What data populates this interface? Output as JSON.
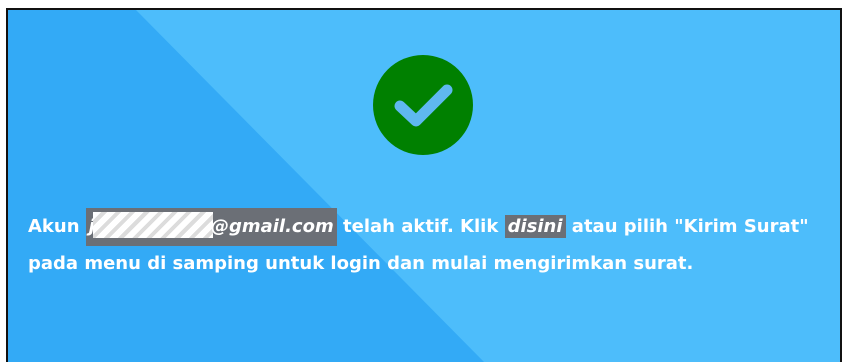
{
  "colors": {
    "background_light": "#4dbdfb",
    "background_dark": "#2fa9f5",
    "check_circle": "#008000",
    "highlight": "#6b6f76",
    "text": "#ffffff"
  },
  "icon": {
    "name": "check-circle-icon"
  },
  "message": {
    "prefix": "Akun ",
    "email_start": "j",
    "email_end": "@gmail.com",
    "middle": " telah aktif. Klik ",
    "link": "disini",
    "suffix": " atau pilih \"Kirim Surat\" pada menu di samping untuk login dan mulai mengirimkan surat."
  }
}
